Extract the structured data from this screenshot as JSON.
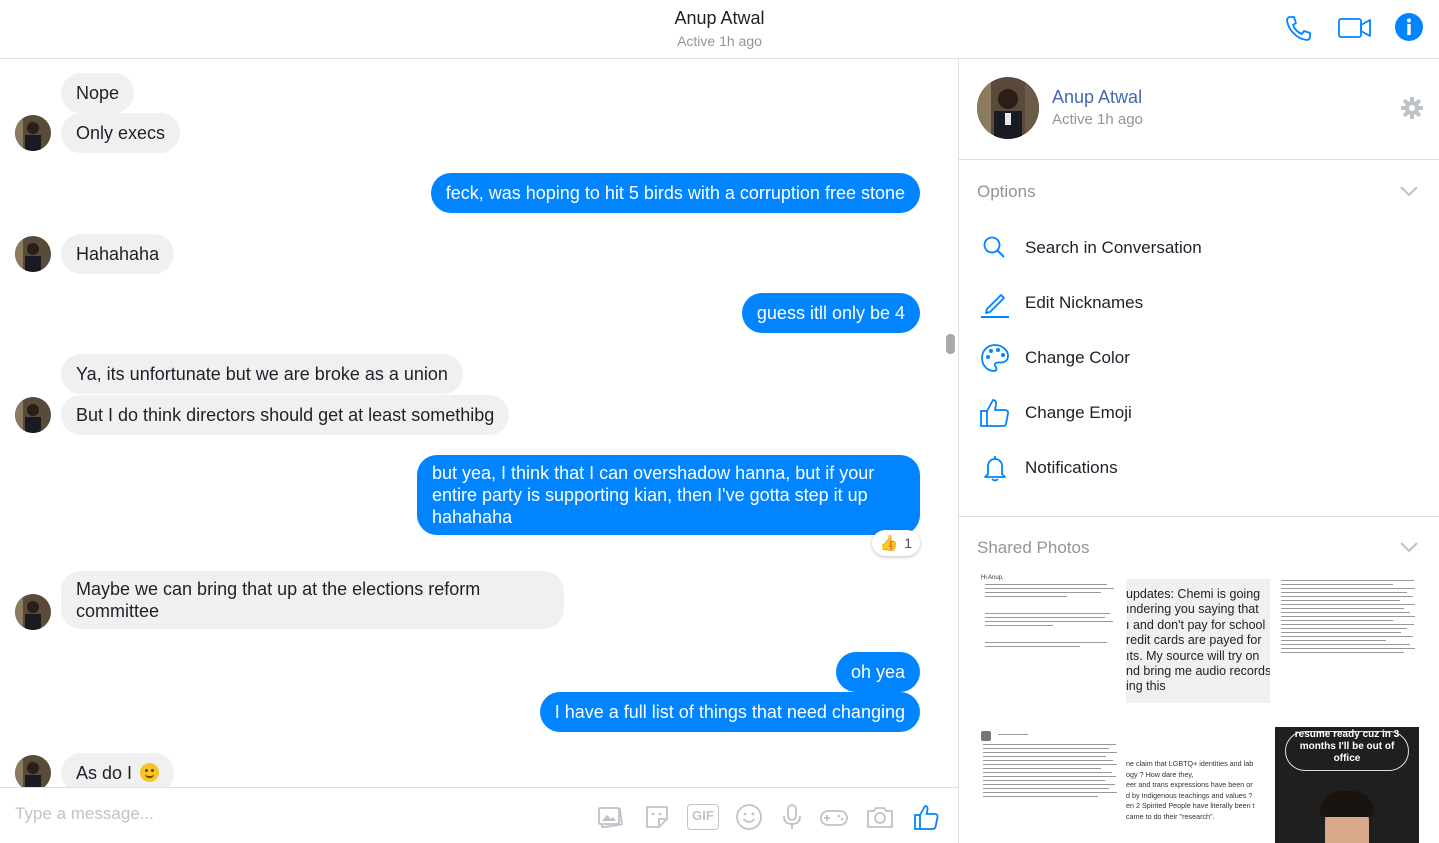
{
  "header": {
    "name": "Anup Atwal",
    "status": "Active 1h ago",
    "icons": [
      "phone-icon",
      "video-camera-icon",
      "info-icon"
    ],
    "accent": "#0084ff"
  },
  "messages": [
    {
      "from": "them",
      "text": "Nope"
    },
    {
      "from": "them",
      "text": "Only execs"
    },
    {
      "from": "me",
      "text": "feck, was hoping to hit 5 birds with a corruption free stone"
    },
    {
      "from": "them",
      "text": "Hahahaha"
    },
    {
      "from": "me",
      "text": "guess itll only be 4"
    },
    {
      "from": "them",
      "text": "Ya, its unfortunate but we are broke as a union"
    },
    {
      "from": "them",
      "text": "But I do think directors should get at least somethibg"
    },
    {
      "from": "me",
      "text": "but yea, I think that I can overshadow hanna, but if your entire party is supporting kian, then I've gotta step it up hahahaha"
    },
    {
      "from": "them",
      "text": "Maybe we can bring that up at the elections reform committee"
    },
    {
      "from": "me",
      "text": "oh yea"
    },
    {
      "from": "me",
      "text": "I have a full list of things that need changing"
    },
    {
      "from": "them",
      "text": "As do I"
    }
  ],
  "reaction": {
    "emoji": "thumbs-up-icon",
    "count": "1"
  },
  "composer": {
    "placeholder": "Type a message...",
    "icons": [
      "photo-icon",
      "sticker-icon",
      "gif-icon",
      "emoji-icon",
      "microphone-icon",
      "game-controller-icon",
      "camera-icon",
      "like-icon"
    ],
    "gif_label": "GIF"
  },
  "panel": {
    "name": "Anup Atwal",
    "status": "Active 1h ago",
    "options_title": "Options",
    "options": [
      {
        "label": "Search in Conversation",
        "icon": "search-icon"
      },
      {
        "label": "Edit Nicknames",
        "icon": "pencil-icon"
      },
      {
        "label": "Change Color",
        "icon": "palette-icon"
      },
      {
        "label": "Change Emoji",
        "icon": "thumbs-up-icon"
      },
      {
        "label": "Notifications",
        "icon": "bell-icon"
      }
    ],
    "shared_photos_title": "Shared Photos",
    "photos": [
      {
        "text": "Hi Anup,"
      },
      {
        "text": "updates: Chemi is going\nındering you saying that\nı and don't pay for school\nredit cards are payed for\nıts. My source will try on\nnd bring me audio records\ning this"
      },
      {
        "text": ""
      },
      {
        "text": ""
      },
      {
        "text": "ne claim that LGBTQ+ identities and lab\nogy ? How dare they,\neer and trans expressions have been or\nd by Indigenous teachings and values ?\nen 2 Spirited People have literally been t\ncame to do their \"research\"."
      },
      {
        "text": "resume ready cuz in 3 months I'll be out of office"
      }
    ]
  }
}
